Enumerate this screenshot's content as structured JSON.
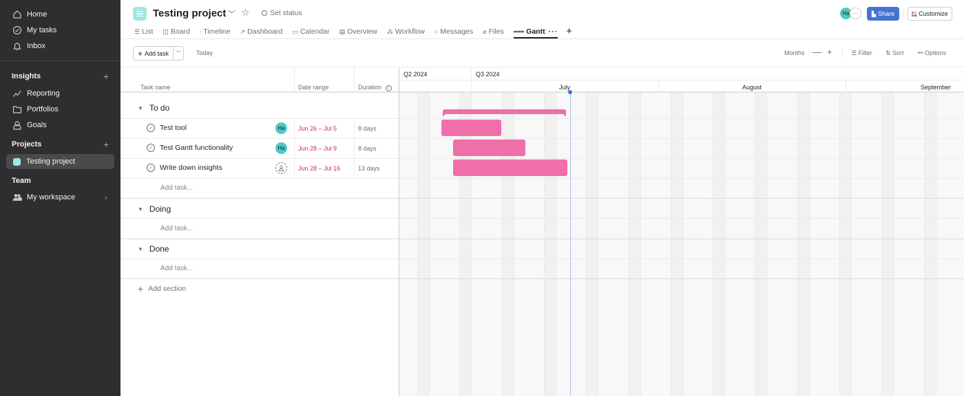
{
  "sidebar": {
    "top_items": [
      {
        "label": "Home",
        "icon": "home-icon"
      },
      {
        "label": "My tasks",
        "icon": "check-circle-icon"
      },
      {
        "label": "Inbox",
        "icon": "bell-icon"
      }
    ],
    "insights": {
      "heading": "Insights",
      "items": [
        {
          "label": "Reporting",
          "icon": "line-chart-icon"
        },
        {
          "label": "Portfolios",
          "icon": "folder-icon"
        },
        {
          "label": "Goals",
          "icon": "person-icon"
        }
      ]
    },
    "projects": {
      "heading": "Projects",
      "items": [
        {
          "label": "Testing project",
          "color": "#9ee7e3"
        }
      ]
    },
    "team": {
      "heading": "Team",
      "items": [
        {
          "label": "My workspace",
          "icon": "people-icon"
        }
      ]
    }
  },
  "header": {
    "project_title": "Testing project",
    "set_status": "Set status",
    "tabs": [
      {
        "label": "List",
        "icon": "list-icon"
      },
      {
        "label": "Board",
        "icon": "board-icon"
      },
      {
        "label": "Timeline",
        "icon": "timeline-icon"
      },
      {
        "label": "Dashboard",
        "icon": "dashboard-icon"
      },
      {
        "label": "Calendar",
        "icon": "calendar-icon"
      },
      {
        "label": "Overview",
        "icon": "overview-icon"
      },
      {
        "label": "Workflow",
        "icon": "workflow-icon"
      },
      {
        "label": "Messages",
        "icon": "message-icon"
      },
      {
        "label": "Files",
        "icon": "paperclip-icon"
      },
      {
        "label": "Gantt",
        "icon": "gantt-icon",
        "active": true
      }
    ],
    "tab_more": "···",
    "avatar_initials": "Ha",
    "more_members": "···",
    "share_label": "Share",
    "customize_label": "Customize"
  },
  "toolbar": {
    "add_task": "Add task",
    "today": "Today",
    "zoom_level": "Months",
    "zoom_out": "—",
    "zoom_in": "+",
    "filter": "Filter",
    "sort": "Sort",
    "options": "Options"
  },
  "columns": {
    "task_name": "Task name",
    "date_range": "Date range",
    "duration": "Duration"
  },
  "sections": [
    {
      "name": "To do",
      "tasks": [
        {
          "name": "Test tool",
          "assignee": "Ha",
          "date_range": "Jun 26 – Jul 5",
          "duration": "8 days"
        },
        {
          "name": "Test Gantt functionality",
          "assignee": "Ha",
          "date_range": "Jun 28 – Jul 9",
          "duration": "8 days"
        },
        {
          "name": "Write down insights",
          "assignee": null,
          "date_range": "Jun 28 – Jul 16",
          "duration": "13 days"
        }
      ],
      "add_task": "Add task..."
    },
    {
      "name": "Doing",
      "tasks": [],
      "add_task": "Add task..."
    },
    {
      "name": "Done",
      "tasks": [],
      "add_task": "Add task..."
    }
  ],
  "add_section": "Add section",
  "timeline": {
    "quarters": [
      "Q2 2024",
      "Q3 2024"
    ],
    "months": [
      "July",
      "August",
      "September"
    ],
    "bar_color": "#f06eaa",
    "today_color": "#4573d2"
  }
}
